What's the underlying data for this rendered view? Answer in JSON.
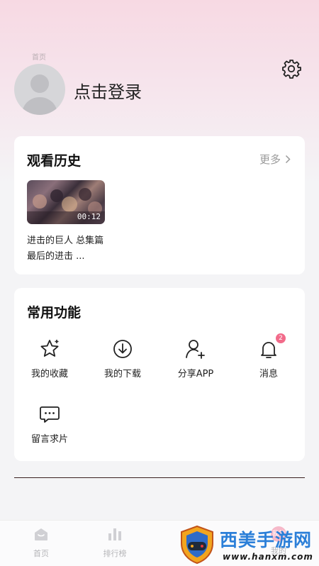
{
  "status_ghost": {
    "home_label": "首页"
  },
  "header": {
    "login_label": "点击登录",
    "settings_icon": "gear-icon"
  },
  "history": {
    "title": "观看历史",
    "more_label": "更多",
    "items": [
      {
        "duration": "00:12",
        "title": "进击的巨人 总集篇 最后的进击 ..."
      }
    ]
  },
  "functions": {
    "title": "常用功能",
    "items": [
      {
        "label": "我的收藏",
        "icon": "star-icon"
      },
      {
        "label": "我的下载",
        "icon": "download-icon"
      },
      {
        "label": "分享APP",
        "icon": "add-user-icon"
      },
      {
        "label": "消息",
        "icon": "bell-icon",
        "badge": "2"
      },
      {
        "label": "留言求片",
        "icon": "message-icon"
      }
    ]
  },
  "tabbar": {
    "tabs": [
      {
        "label": "首页",
        "icon": "home-icon"
      },
      {
        "label": "排行榜",
        "icon": "ranking-icon"
      },
      {
        "label": "我的",
        "icon": "profile-icon",
        "bubble_text": "我的"
      }
    ]
  },
  "watermark": {
    "title": "西美手游网",
    "url": "www.hanxm.com"
  },
  "colors": {
    "accent_pink": "#f26b8a",
    "watermark_blue": "#2b7fd8",
    "header_gradient": "#f7d9e3"
  }
}
